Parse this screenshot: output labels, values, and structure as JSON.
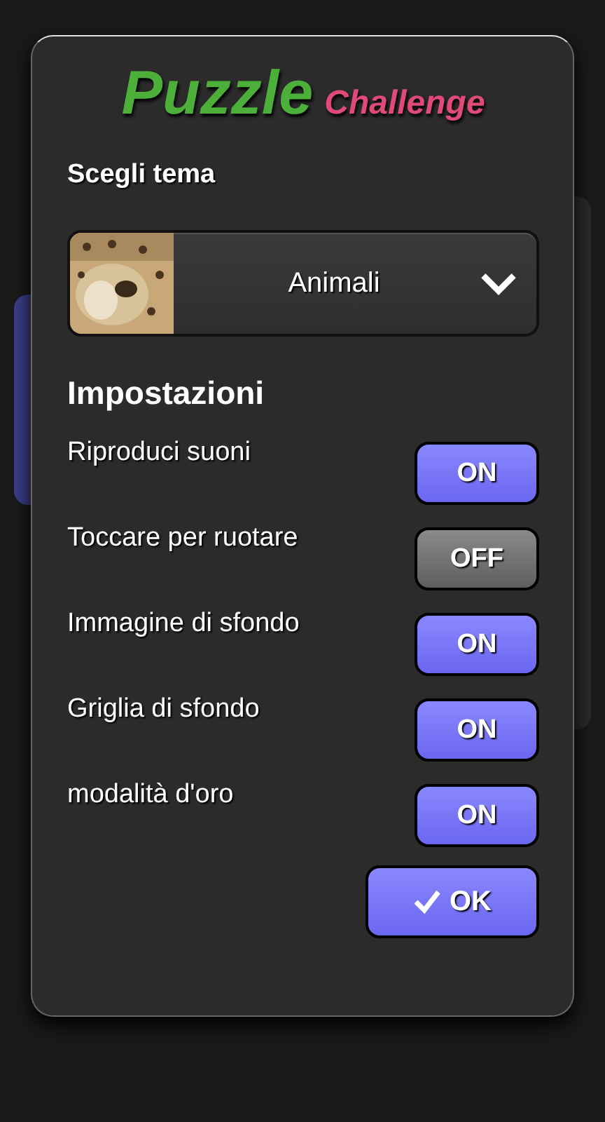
{
  "logo": {
    "word_1": "Puzzle",
    "word_2": "Challenge"
  },
  "theme": {
    "label": "Scegli tema",
    "value": "Animali"
  },
  "settings_title": "Impostazioni",
  "settings": [
    {
      "label": "Riproduci suoni",
      "on": true,
      "button": "ON"
    },
    {
      "label": "Toccare per ruotare",
      "on": false,
      "button": "OFF"
    },
    {
      "label": "Immagine di sfondo",
      "on": true,
      "button": "ON"
    },
    {
      "label": "Griglia di sfondo",
      "on": true,
      "button": "ON"
    },
    {
      "label": "modalità d'oro",
      "on": true,
      "button": "ON"
    }
  ],
  "ok_button": "OK"
}
